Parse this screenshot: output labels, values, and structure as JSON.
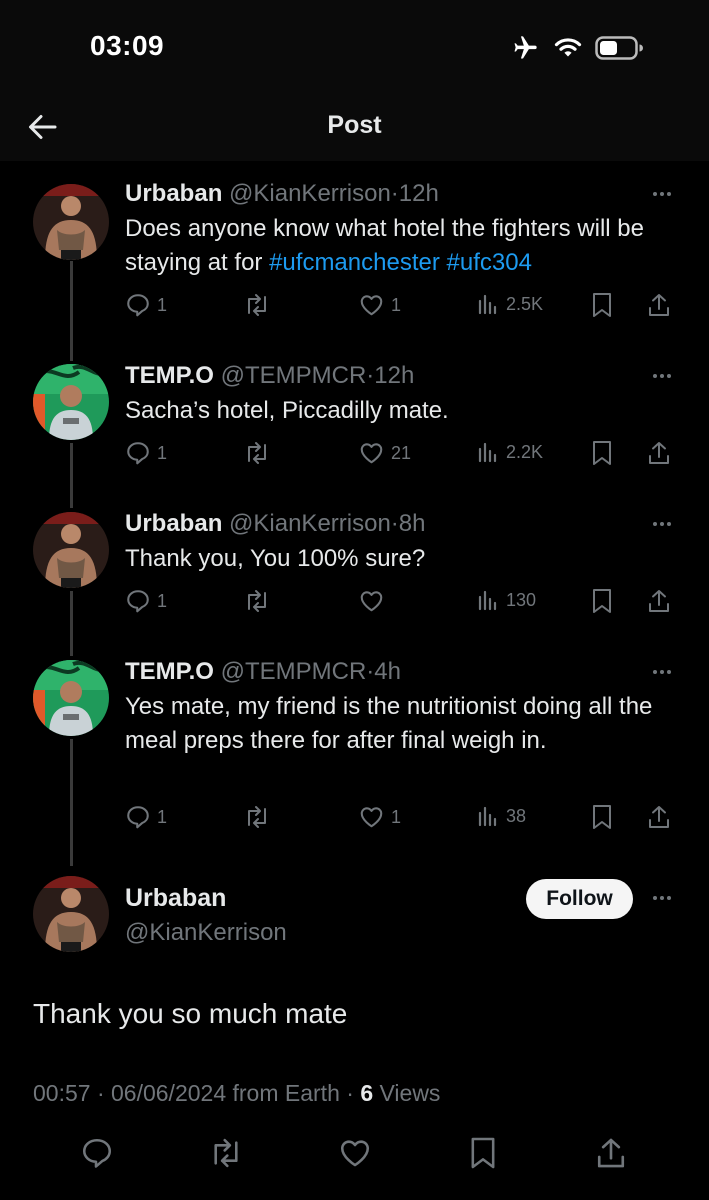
{
  "status_bar": {
    "time": "03:09",
    "icons": [
      "airplane-icon",
      "wifi-icon",
      "battery-icon"
    ]
  },
  "header": {
    "back_icon": "back-arrow-icon",
    "title": "Post"
  },
  "colors": {
    "background": "#000000",
    "text": "#e7e9ea",
    "muted": "#71767b",
    "link": "#1d9bf0",
    "thread_line": "#3a3a3a"
  },
  "replies": [
    {
      "name": "Urbaban",
      "handle": "@KianKerrison",
      "time": "12h",
      "text_parts": [
        "Does anyone know what hotel the fighters will be staying at for ",
        "#ufcmanchester",
        " ",
        "#ufc304"
      ],
      "replies": "1",
      "reposts": "",
      "likes": "1",
      "views": "2.5K"
    },
    {
      "name": "TEMP.O",
      "handle": "@TEMPMCR",
      "time": "12h",
      "text": "Sacha’s hotel, Piccadilly mate.",
      "replies": "1",
      "reposts": "",
      "likes": "21",
      "views": "2.2K"
    },
    {
      "name": "Urbaban",
      "handle": "@KianKerrison",
      "time": "8h",
      "text": "Thank you, You 100% sure?",
      "replies": "1",
      "reposts": "",
      "likes": "",
      "views": "130"
    },
    {
      "name": "TEMP.O",
      "handle": "@TEMPMCR",
      "time": "4h",
      "text": "Yes mate, my friend is the nutritionist doing all the meal preps there for after final weigh in.",
      "replies": "1",
      "reposts": "",
      "likes": "1",
      "views": "38"
    }
  ],
  "main_post": {
    "name": "Urbaban",
    "handle": "@KianKerrison",
    "follow_label": "Follow",
    "text": "Thank you so much mate",
    "timestamp": "00:57 · 06/06/2024 from Earth · ",
    "views_count": "6",
    "views_label": " Views"
  }
}
